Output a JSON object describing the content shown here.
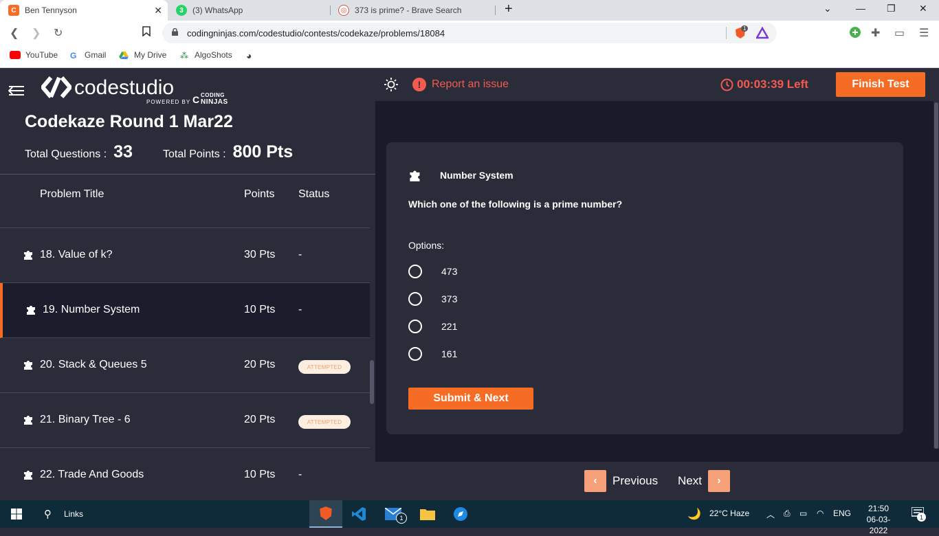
{
  "browser": {
    "tabs": [
      {
        "label": "Ben Tennyson",
        "active": true
      },
      {
        "label": "(3) WhatsApp",
        "badge": "3"
      },
      {
        "label": "373 is prime? - Brave Search"
      }
    ],
    "new_tab": "+",
    "url": "codingninjas.com/codestudio/contests/codekaze/problems/18084",
    "bookmarks": [
      "YouTube",
      "Gmail",
      "My Drive",
      "AlgoShots"
    ],
    "brave_badge": "1"
  },
  "logo": {
    "name": "codestudio",
    "powered_by": "POWERED BY",
    "brand_top": "CODING",
    "brand_bottom": "NINJAS"
  },
  "contest": {
    "title": "Codekaze Round 1 Mar22",
    "total_questions_label": "Total Questions :",
    "total_questions": "33",
    "total_points_label": "Total Points :",
    "total_points": "800 Pts"
  },
  "table": {
    "headers": {
      "title": "Problem Title",
      "points": "Points",
      "status": "Status"
    },
    "rows": [
      {
        "title": "18. Value of k?",
        "points": "30 Pts",
        "status": "-"
      },
      {
        "title": "19. Number System",
        "points": "10 Pts",
        "status": "-"
      },
      {
        "title": "20. Stack & Queues 5",
        "points": "20 Pts",
        "status": "ATTEMPTED"
      },
      {
        "title": "21. Binary Tree - 6",
        "points": "20 Pts",
        "status": "ATTEMPTED"
      },
      {
        "title": "22. Trade And Goods",
        "points": "10 Pts",
        "status": "-"
      }
    ]
  },
  "topbar": {
    "report": "Report an issue",
    "timer": "00:03:39 Left",
    "finish": "Finish Test"
  },
  "question": {
    "category": "Number System",
    "text": "Which one of the following is a prime number?",
    "options_label": "Options:",
    "options": [
      "473",
      "373",
      "221",
      "161"
    ],
    "submit": "Submit & Next"
  },
  "pager": {
    "previous": "Previous",
    "next": "Next"
  },
  "taskbar": {
    "search": "Links",
    "mail_badge": "1",
    "weather": "22°C  Haze",
    "lang": "ENG",
    "time": "21:50",
    "date": "06-03-2022",
    "notif": "1"
  },
  "colors": {
    "accent": "#f66c24",
    "danger": "#f55a4e",
    "panel": "#2b2c3a",
    "bg": "#191a2a"
  }
}
